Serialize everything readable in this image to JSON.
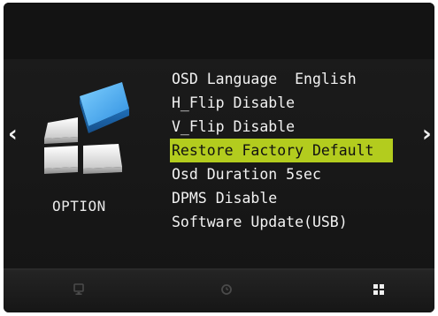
{
  "navigation": {
    "left_arrow": "‹",
    "right_arrow": "›"
  },
  "category": {
    "label": "OPTION",
    "icon": "option-blocks-icon"
  },
  "menu": {
    "items": [
      {
        "label": "OSD Language",
        "value": "English",
        "gap": "  "
      },
      {
        "label": "H_Flip",
        "value": "Disable",
        "gap": " "
      },
      {
        "label": "V_Flip",
        "value": "Disable",
        "gap": " "
      },
      {
        "label": "Restore Factory Default",
        "value": "",
        "gap": ""
      },
      {
        "label": "Osd Duration",
        "value": "5sec",
        "gap": " "
      },
      {
        "label": "DPMS",
        "value": "Disable",
        "gap": " "
      },
      {
        "label": "Software Update(USB)",
        "value": "",
        "gap": ""
      }
    ],
    "selected_index": 3
  },
  "bottom_tabs": [
    {
      "name": "monitor-icon"
    },
    {
      "name": "clock-icon"
    },
    {
      "name": "grid-icon",
      "active": true
    }
  ],
  "colors": {
    "highlight": "#b3cc1e",
    "text": "#f2f2f2",
    "accent_blue": "#3a9be0"
  }
}
